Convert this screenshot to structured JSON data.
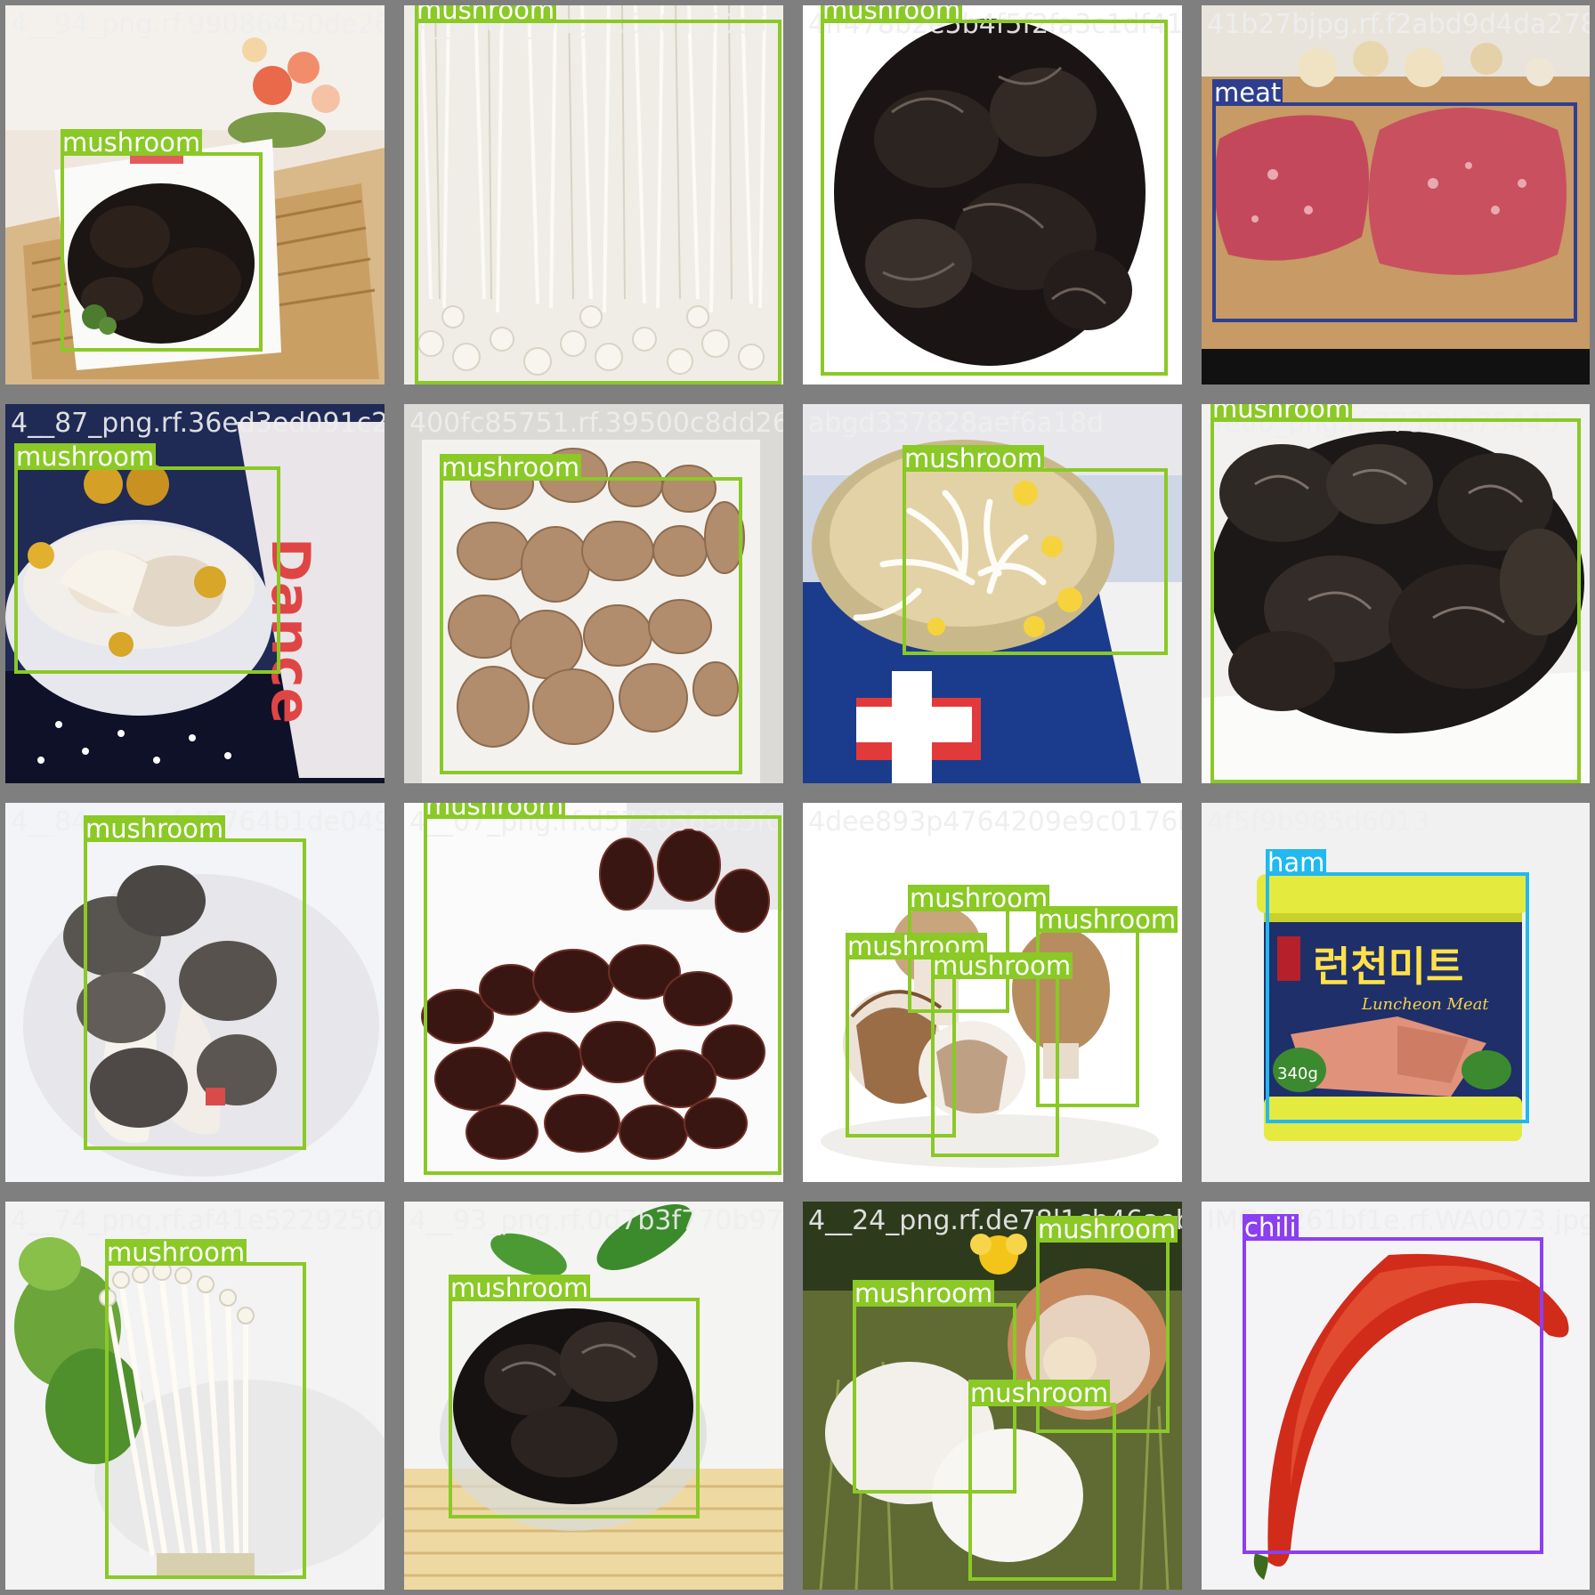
{
  "colors": {
    "mushroom": "#8ac926",
    "meat": "#2f3f8f",
    "ham": "#22b8f0",
    "chili": "#8b3ff0"
  },
  "tiles": [
    {
      "filename": "4__94_png.rf.99086450de26473f0d8f0e69a39d015b4ce9ff478b2e5b4f5f2fa3c1df41135",
      "scene": "black-fungus-bowl-on-mat",
      "detections": [
        {
          "label": "mushroom"
        }
      ]
    },
    {
      "filename": "4__enoki_png.rf.6e0a8f0c6a5364015b4ce",
      "scene": "enoki-closeup",
      "detections": [
        {
          "label": "mushroom"
        }
      ]
    },
    {
      "filename": "4ff478b2e5b4f5f2fa3c1df41135",
      "scene": "black-fungus-heap",
      "detections": [
        {
          "label": "mushroom"
        }
      ]
    },
    {
      "filename": "41b27bjpg.rf.f2abd9d4da278",
      "scene": "raw-steaks-on-board",
      "detections": [
        {
          "label": "meat"
        }
      ]
    },
    {
      "filename": "4__87_png.rf.36ed3ed091c2",
      "scene": "oyster-mushroom-bowl",
      "detections": [
        {
          "label": "mushroom"
        }
      ]
    },
    {
      "filename": "400fc85751.rf.39500c8dd26b51606",
      "scene": "button-mushrooms-in-box",
      "detections": [
        {
          "label": "mushroom"
        }
      ]
    },
    {
      "filename": "abgd337828aef6a18d",
      "scene": "mushrooms-in-bowl-on-poster",
      "detections": [
        {
          "label": "mushroom"
        }
      ]
    },
    {
      "filename": "4e06_png.rf.7730da75445",
      "scene": "black-fungus-closeup",
      "detections": [
        {
          "label": "mushroom"
        }
      ]
    },
    {
      "filename": "4__84_png.rf.45764b1de0499",
      "scene": "grey-oyster-mushrooms",
      "detections": [
        {
          "label": "mushroom"
        }
      ]
    },
    {
      "filename": "4__07_png.rf.d5720369d5f0bc",
      "scene": "dried-fungus-pile",
      "detections": [
        {
          "label": "mushroom"
        }
      ]
    },
    {
      "filename": "4dee893p4764209e9c0176b2",
      "scene": "brown-mushrooms-white-background",
      "detections": [
        {
          "label": "mushroom"
        },
        {
          "label": "mushroom"
        },
        {
          "label": "mushroom"
        },
        {
          "label": "mushroom"
        }
      ]
    },
    {
      "filename": "4f5f9b985d6013",
      "scene": "luncheon-meat-can",
      "detections": [
        {
          "label": "ham"
        }
      ],
      "product": {
        "brand_text": "런천미트",
        "sub_text": "Luncheon Meat",
        "weight": "340g"
      }
    },
    {
      "filename": "4__74_png.rf.af41e5229250c0858b",
      "scene": "enoki-bundle",
      "detections": [
        {
          "label": "mushroom"
        }
      ]
    },
    {
      "filename": "4__93_png.rf.0d7b3f770b970fb5e08",
      "scene": "black-fungus-glass-bowl",
      "detections": [
        {
          "label": "mushroom"
        }
      ]
    },
    {
      "filename": "4__24_png.rf.de78l1cb46aebad4",
      "scene": "white-mushrooms-in-grass",
      "detections": [
        {
          "label": "mushroom"
        },
        {
          "label": "mushroom"
        },
        {
          "label": "mushroom"
        }
      ]
    },
    {
      "filename": "IMG_5261bf1e.rf.WA0073.jpg",
      "scene": "red-chili",
      "detections": [
        {
          "label": "chili"
        }
      ]
    }
  ]
}
